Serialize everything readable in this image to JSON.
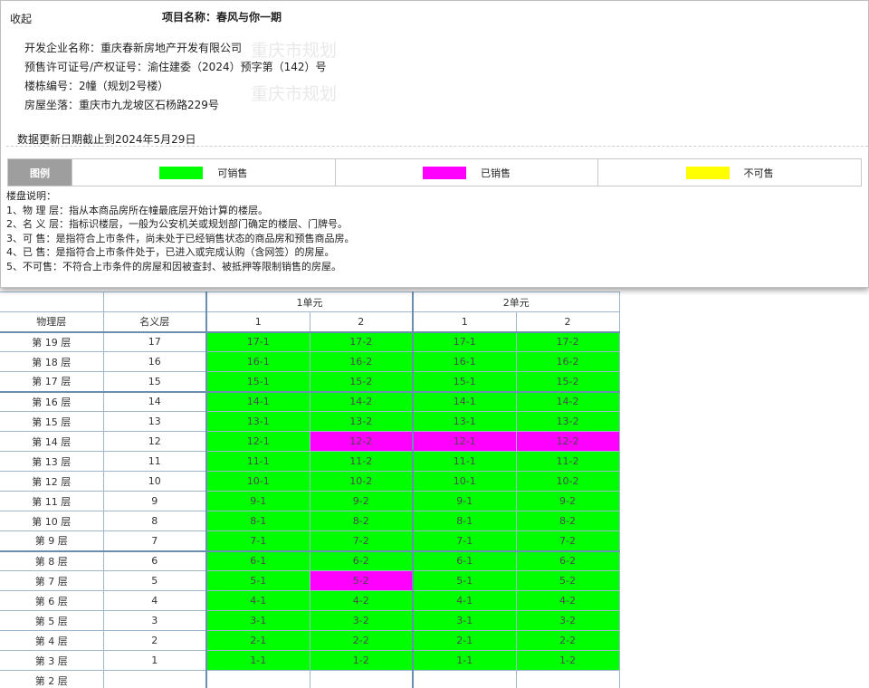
{
  "header": {
    "collapse_label": "收起",
    "project_name": "项目名称：春风与你一期"
  },
  "info": {
    "developer": "开发企业名称：重庆春新房地产开发有限公司",
    "permit": "预售许可证号/产权证号：渝住建委（2024）预字第（142）号",
    "building_no": "楼栋编号：2幢（规划2号楼）",
    "location": "房屋坐落：重庆市九龙坡区石杨路229号",
    "watermark": "重庆市规划"
  },
  "update_date": "数据更新日期截止到2024年5月29日",
  "legend": {
    "header": "图例",
    "items": [
      {
        "label": "可销售",
        "color": "#00ff00"
      },
      {
        "label": "已销售",
        "color": "#ff00ff"
      },
      {
        "label": "不可售",
        "color": "#ffff00"
      }
    ]
  },
  "notes": {
    "title": "楼盘说明：",
    "items": [
      "1、物 理 层：指从本商品房所在幢最底层开始计算的楼层。",
      "2、名 义 层：指标识楼层，一般为公安机关或规划部门确定的楼层、门牌号。",
      "3、可 售：是指符合上市条件，尚未处于已经销售状态的商品房和预售商品房。",
      "4、已 售：是指符合上市条件处于，已进入或完成认购（含网签）的房屋。",
      "5、不可售：不符合上市条件的房屋和因被查封、被抵押等限制销售的房屋。"
    ]
  },
  "status_colors": {
    "available": "#00ff00",
    "sold": "#ff00ff",
    "unavailable": "#ffff00"
  },
  "table": {
    "units": [
      {
        "name": "1单元",
        "rooms": [
          "1",
          "2"
        ]
      },
      {
        "name": "2单元",
        "rooms": [
          "1",
          "2"
        ]
      }
    ],
    "col_physical": "物理层",
    "col_nominal": "名义层",
    "rows": [
      {
        "physical": "第 19 层",
        "nominal": "17",
        "cells": [
          {
            "label": "17-1",
            "status": "available"
          },
          {
            "label": "17-2",
            "status": "available"
          },
          {
            "label": "17-1",
            "status": "available"
          },
          {
            "label": "17-2",
            "status": "available"
          }
        ]
      },
      {
        "physical": "第 18 层",
        "nominal": "16",
        "cells": [
          {
            "label": "16-1",
            "status": "available"
          },
          {
            "label": "16-2",
            "status": "available"
          },
          {
            "label": "16-1",
            "status": "available"
          },
          {
            "label": "16-2",
            "status": "available"
          }
        ]
      },
      {
        "physical": "第 17 层",
        "nominal": "15",
        "cells": [
          {
            "label": "15-1",
            "status": "available"
          },
          {
            "label": "15-2",
            "status": "available"
          },
          {
            "label": "15-1",
            "status": "available"
          },
          {
            "label": "15-2",
            "status": "available"
          }
        ]
      },
      {
        "physical": "第 16 层",
        "nominal": "14",
        "cells": [
          {
            "label": "14-1",
            "status": "available"
          },
          {
            "label": "14-2",
            "status": "available"
          },
          {
            "label": "14-1",
            "status": "available"
          },
          {
            "label": "14-2",
            "status": "available"
          }
        ]
      },
      {
        "physical": "第 15 层",
        "nominal": "13",
        "cells": [
          {
            "label": "13-1",
            "status": "available"
          },
          {
            "label": "13-2",
            "status": "available"
          },
          {
            "label": "13-1",
            "status": "available"
          },
          {
            "label": "13-2",
            "status": "available"
          }
        ]
      },
      {
        "physical": "第 14 层",
        "nominal": "12",
        "cells": [
          {
            "label": "12-1",
            "status": "available"
          },
          {
            "label": "12-2",
            "status": "sold"
          },
          {
            "label": "12-1",
            "status": "sold"
          },
          {
            "label": "12-2",
            "status": "sold"
          }
        ]
      },
      {
        "physical": "第 13 层",
        "nominal": "11",
        "cells": [
          {
            "label": "11-1",
            "status": "available"
          },
          {
            "label": "11-2",
            "status": "available"
          },
          {
            "label": "11-1",
            "status": "available"
          },
          {
            "label": "11-2",
            "status": "available"
          }
        ]
      },
      {
        "physical": "第 12 层",
        "nominal": "10",
        "cells": [
          {
            "label": "10-1",
            "status": "available"
          },
          {
            "label": "10-2",
            "status": "available"
          },
          {
            "label": "10-1",
            "status": "available"
          },
          {
            "label": "10-2",
            "status": "available"
          }
        ]
      },
      {
        "physical": "第 11 层",
        "nominal": "9",
        "cells": [
          {
            "label": "9-1",
            "status": "available"
          },
          {
            "label": "9-2",
            "status": "available"
          },
          {
            "label": "9-1",
            "status": "available"
          },
          {
            "label": "9-2",
            "status": "available"
          }
        ]
      },
      {
        "physical": "第 10 层",
        "nominal": "8",
        "cells": [
          {
            "label": "8-1",
            "status": "available"
          },
          {
            "label": "8-2",
            "status": "available"
          },
          {
            "label": "8-1",
            "status": "available"
          },
          {
            "label": "8-2",
            "status": "available"
          }
        ]
      },
      {
        "physical": "第 9 层",
        "nominal": "7",
        "cells": [
          {
            "label": "7-1",
            "status": "available"
          },
          {
            "label": "7-2",
            "status": "available"
          },
          {
            "label": "7-1",
            "status": "available"
          },
          {
            "label": "7-2",
            "status": "available"
          }
        ]
      },
      {
        "physical": "第 8 层",
        "nominal": "6",
        "cells": [
          {
            "label": "6-1",
            "status": "available"
          },
          {
            "label": "6-2",
            "status": "available"
          },
          {
            "label": "6-1",
            "status": "available"
          },
          {
            "label": "6-2",
            "status": "available"
          }
        ]
      },
      {
        "physical": "第 7 层",
        "nominal": "5",
        "cells": [
          {
            "label": "5-1",
            "status": "available"
          },
          {
            "label": "5-2",
            "status": "sold"
          },
          {
            "label": "5-1",
            "status": "available"
          },
          {
            "label": "5-2",
            "status": "available"
          }
        ]
      },
      {
        "physical": "第 6 层",
        "nominal": "4",
        "cells": [
          {
            "label": "4-1",
            "status": "available"
          },
          {
            "label": "4-2",
            "status": "available"
          },
          {
            "label": "4-1",
            "status": "available"
          },
          {
            "label": "4-2",
            "status": "available"
          }
        ]
      },
      {
        "physical": "第 5 层",
        "nominal": "3",
        "cells": [
          {
            "label": "3-1",
            "status": "available"
          },
          {
            "label": "3-2",
            "status": "available"
          },
          {
            "label": "3-1",
            "status": "available"
          },
          {
            "label": "3-2",
            "status": "available"
          }
        ]
      },
      {
        "physical": "第 4 层",
        "nominal": "2",
        "cells": [
          {
            "label": "2-1",
            "status": "available"
          },
          {
            "label": "2-2",
            "status": "available"
          },
          {
            "label": "2-1",
            "status": "available"
          },
          {
            "label": "2-2",
            "status": "available"
          }
        ]
      },
      {
        "physical": "第 3 层",
        "nominal": "1",
        "cells": [
          {
            "label": "1-1",
            "status": "available"
          },
          {
            "label": "1-2",
            "status": "available"
          },
          {
            "label": "1-1",
            "status": "available"
          },
          {
            "label": "1-2",
            "status": "available"
          }
        ]
      },
      {
        "physical": "第 2 层",
        "nominal": "",
        "cells": [
          {
            "label": "",
            "status": "empty"
          },
          {
            "label": "",
            "status": "empty"
          },
          {
            "label": "",
            "status": "empty"
          },
          {
            "label": "",
            "status": "empty"
          }
        ]
      }
    ]
  }
}
